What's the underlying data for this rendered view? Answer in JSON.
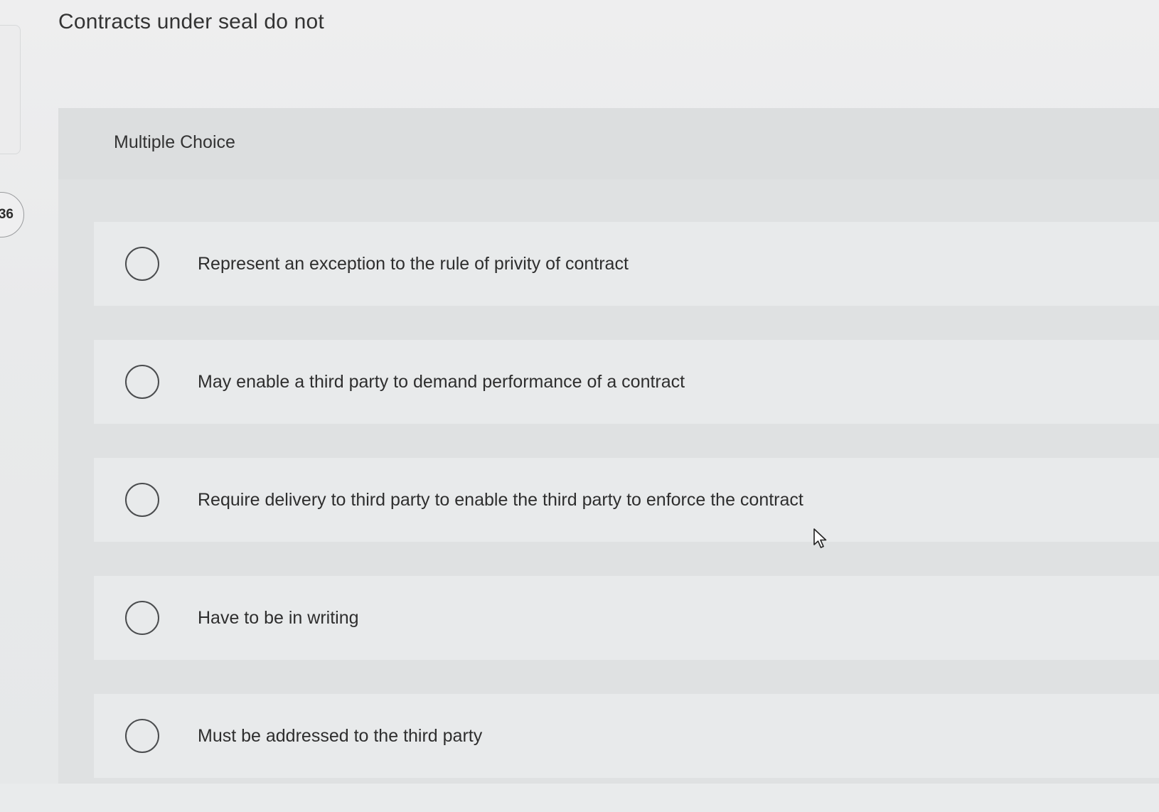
{
  "question": {
    "number": "36",
    "text": "Contracts under seal do not",
    "type_label": "Multiple Choice"
  },
  "choices": [
    {
      "text": "Represent an exception to the rule of privity of contract",
      "selected": false
    },
    {
      "text": "May enable a third party to demand performance of a contract",
      "selected": false
    },
    {
      "text": "Require delivery to third party to enable the third party to enforce the contract",
      "selected": false
    },
    {
      "text": "Have to be in writing",
      "selected": false
    },
    {
      "text": "Must be addressed to the third party",
      "selected": false
    }
  ],
  "icons": {
    "radio": "radio-button-icon",
    "cursor": "mouse-pointer-icon"
  }
}
